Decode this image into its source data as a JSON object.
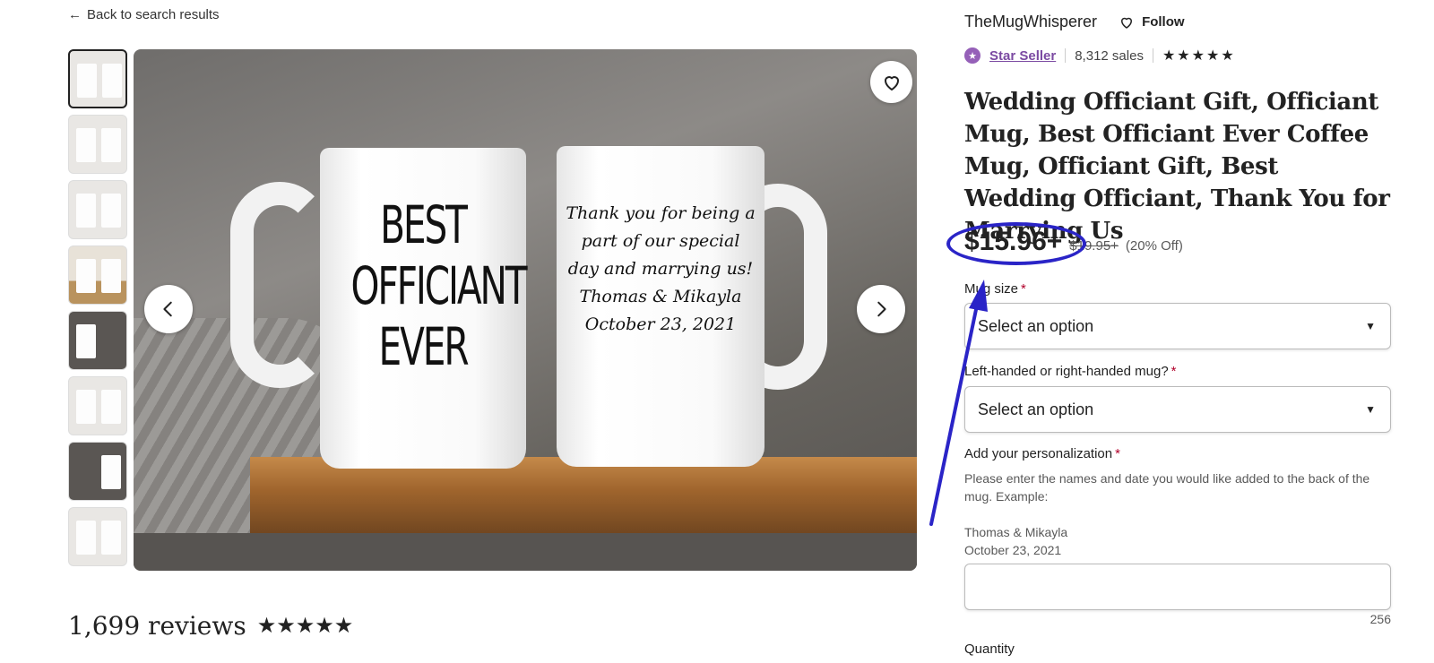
{
  "nav": {
    "back_label": "Back to search results"
  },
  "gallery": {
    "mug_left_text": "BEST OFFICIANT EVER",
    "mug_right_text": "Thank you for being a part of our special day and marrying us! Thomas & Mikayla October 23, 2021"
  },
  "reviews": {
    "count_label": "1,699 reviews",
    "stars": "★★★★★"
  },
  "shop": {
    "name": "TheMugWhisperer",
    "follow_label": "Follow",
    "star_seller_label": "Star Seller",
    "sales": "8,312 sales",
    "stars": "★★★★★"
  },
  "listing": {
    "title": "Wedding Officiant Gift, Officiant Mug, Best Officiant Ever Coffee Mug, Officiant Gift, Best Wedding Officiant, Thank You for Marrying Us",
    "price": "$15.96+",
    "old_price": "$19.95+",
    "discount": "(20% Off)"
  },
  "options": {
    "mug_size_label": "Mug size",
    "mug_size_value": "Select an option",
    "handedness_label": "Left-handed or right-handed mug?",
    "handedness_value": "Select an option",
    "required_mark": "*"
  },
  "personalization": {
    "label": "Add your personalization",
    "help": "Please enter the names and date you would like added to the back of the mug. Example:",
    "example_line1": "Thomas & Mikayla",
    "example_line2": "October 23, 2021",
    "char_count": "256"
  },
  "quantity": {
    "label": "Quantity"
  },
  "annotation": {
    "color": "#2a24c7"
  }
}
